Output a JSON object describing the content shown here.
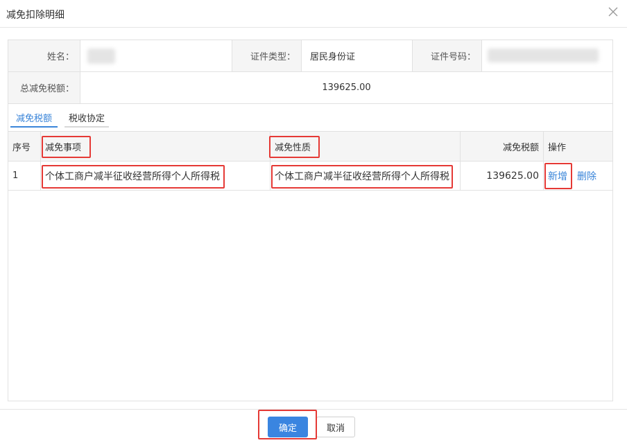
{
  "dialog": {
    "title": "减免扣除明细",
    "close_icon": "close-icon"
  },
  "info": {
    "name_label": "姓名：",
    "id_type_label": "证件类型：",
    "id_type_value": "居民身份证",
    "id_number_label": "证件号码：",
    "total_label": "总减免税额：",
    "total_value": "139625.00"
  },
  "tabs": [
    {
      "label": "减免税额",
      "active": true
    },
    {
      "label": "税收协定",
      "active": false
    }
  ],
  "table": {
    "headers": [
      "序号",
      "减免事项",
      "减免性质",
      "减免税额",
      "操作"
    ],
    "rows": [
      {
        "index": "1",
        "item": "个体工商户减半征收经营所得个人所得税",
        "nature": "个体工商户减半征收经营所得个人所得税",
        "amount": "139625.00",
        "actions": [
          "新增",
          "删除"
        ]
      }
    ]
  },
  "footer": {
    "ok_label": "确定",
    "cancel_label": "取消"
  },
  "colors": {
    "accent": "#3a85d9",
    "highlight": "#e53935",
    "header_bg": "#f5f5f5"
  }
}
